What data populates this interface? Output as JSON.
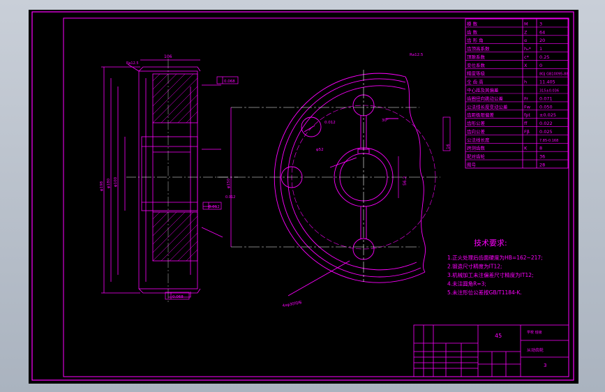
{
  "colors": {
    "background": "#000000",
    "line": "#ff00ff",
    "centerline": "#ffffff",
    "frame": "#ff00ff"
  },
  "params": [
    {
      "name": "模 数",
      "sym": "M",
      "val": "3"
    },
    {
      "name": "齿 数",
      "sym": "Z",
      "val": "64"
    },
    {
      "name": "齿 形 角",
      "sym": "α",
      "val": "20"
    },
    {
      "name": "齿顶高系数",
      "sym": "hₐ*",
      "val": "1"
    },
    {
      "name": "顶隙系数",
      "sym": "c*",
      "val": "0.25"
    },
    {
      "name": "变位系数",
      "sym": "X",
      "val": "0"
    },
    {
      "name": "精度等级",
      "sym": "",
      "val": "8GJ GB10095-88"
    },
    {
      "name": "全 齿 高",
      "sym": "h",
      "val": "11.405"
    },
    {
      "name": "中心距及其偏差",
      "sym": "",
      "val": "315±0.036"
    },
    {
      "name": "齿圈径向跳动公差",
      "sym": "Fr",
      "val": "0.071"
    },
    {
      "name": "公法线长度变动公差",
      "sym": "Fw",
      "val": "0.050"
    },
    {
      "name": "齿距极限偏差",
      "sym": "fpt",
      "val": "±0.025"
    },
    {
      "name": "齿形公差",
      "sym": "ff",
      "val": "0.022"
    },
    {
      "name": "齿向公差",
      "sym": "Fβ",
      "val": "0.025"
    },
    {
      "name": "公法线长度",
      "sym": "",
      "val": "7.85-0.168"
    },
    {
      "name": "跨测齿数",
      "sym": "K",
      "val": "8"
    },
    {
      "name": "配对齿轮",
      "sym": "",
      "val": "36"
    },
    {
      "name": "图号",
      "sym": "",
      "val": "28"
    }
  ],
  "tech_title": "技术要求:",
  "tech_reqs": [
    "1.正火处理后齿面硬度为HB=162~217;",
    "2.锻造尺寸精度为IT12;",
    "3.机械加工未注偏差尺寸精度为IT12;",
    "4.未注圆角R=3;",
    "5.未注形位公差按GB/T1184-K."
  ],
  "title_block": {
    "mark": "45",
    "school": "学校 班级",
    "part": "从动齿轮",
    "sheet": "3"
  },
  "dims": {
    "width": "106",
    "d_outer": "φ198",
    "d_root": "φ180",
    "d_hub": "φ100",
    "bore": "φ52",
    "keyway": "16",
    "kw_depth": "56.2",
    "holes": "4xφ30均布",
    "runout": "0.068",
    "flat": "0.012",
    "hub_runout": "0.012",
    "pcd": "φ150",
    "rough": "Ra12.5",
    "angle": "30°"
  }
}
